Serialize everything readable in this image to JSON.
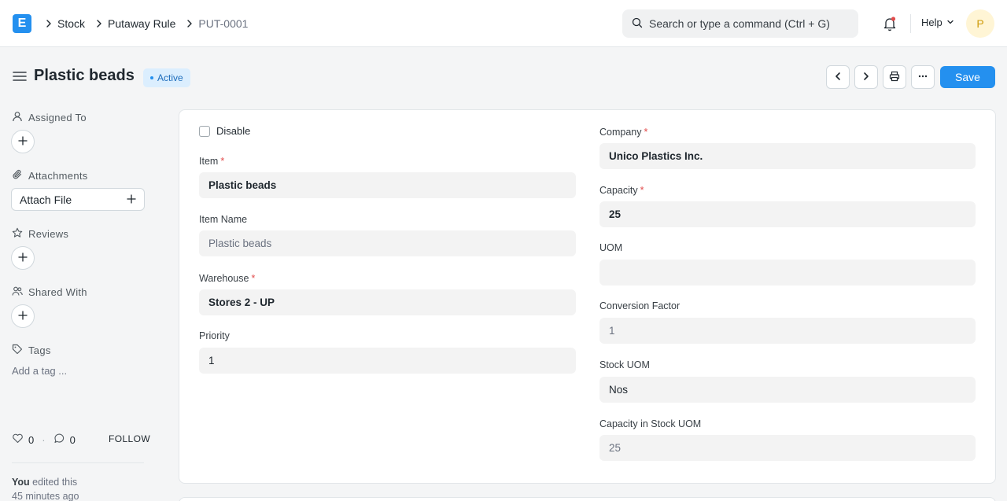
{
  "navbar": {
    "logo_letter": "E",
    "breadcrumbs": [
      "Stock",
      "Putaway Rule",
      "PUT-0001"
    ],
    "search_placeholder": "Search or type a command (Ctrl + G)",
    "help_label": "Help",
    "avatar_initial": "P"
  },
  "page": {
    "title": "Plastic beads",
    "status": "Active",
    "save_label": "Save"
  },
  "sidebar": {
    "assigned_to": "Assigned To",
    "attachments": "Attachments",
    "attach_file": "Attach File",
    "reviews": "Reviews",
    "shared_with": "Shared With",
    "tags": "Tags",
    "add_tag": "Add a tag ...",
    "likes": "0",
    "comments": "0",
    "follow": "FOLLOW",
    "activity_user": "You",
    "activity_text": " edited this",
    "activity_time": "45 minutes ago"
  },
  "form": {
    "disable_label": "Disable",
    "item_label": "Item",
    "item_value": "Plastic beads",
    "item_name_label": "Item Name",
    "item_name_value": "Plastic beads",
    "warehouse_label": "Warehouse",
    "warehouse_value": "Stores 2 - UP",
    "priority_label": "Priority",
    "priority_value": "1",
    "company_label": "Company",
    "company_value": "Unico Plastics Inc.",
    "capacity_label": "Capacity",
    "capacity_value": "25",
    "uom_label": "UOM",
    "uom_value": "",
    "conversion_label": "Conversion Factor",
    "conversion_value": "1",
    "stock_uom_label": "Stock UOM",
    "stock_uom_value": "Nos",
    "capacity_stock_label": "Capacity in Stock UOM",
    "capacity_stock_value": "25",
    "required_mark": "*"
  },
  "colors": {
    "accent": "#2490ef",
    "badge_bg": "#dbeefe",
    "required": "#e24c4c"
  }
}
